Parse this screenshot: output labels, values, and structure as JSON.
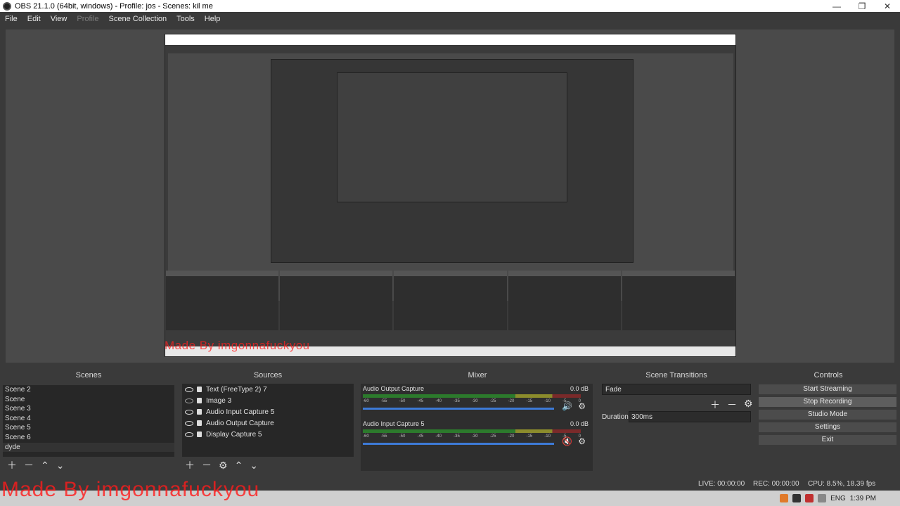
{
  "window": {
    "title": "OBS 21.1.0 (64bit, windows) - Profile: jos - Scenes: kil me",
    "minimize": "—",
    "maximize": "❐",
    "close": "✕"
  },
  "menu": [
    "File",
    "Edit",
    "View",
    "Profile",
    "Scene Collection",
    "Tools",
    "Help"
  ],
  "docks": {
    "scenes": {
      "title": "Scenes",
      "items": [
        "Scene 2",
        "Scene",
        "Scene 3",
        "Scene 4",
        "Scene 5",
        "Scene 6",
        "dyde"
      ]
    },
    "sources": {
      "title": "Sources",
      "items": [
        "Text (FreeType 2) 7",
        "Image 3",
        "Audio Input Capture 5",
        "Audio Output Capture",
        "Display Capture 5"
      ]
    },
    "mixer": {
      "title": "Mixer",
      "channels": [
        {
          "name": "Audio Output Capture",
          "db": "0.0 dB"
        },
        {
          "name": "Audio Input Capture 5",
          "db": "0.0 dB"
        }
      ],
      "ticks": [
        "-60",
        "-55",
        "-50",
        "-45",
        "-40",
        "-35",
        "-30",
        "-25",
        "-20",
        "-15",
        "-10",
        "-5",
        "0"
      ]
    },
    "transitions": {
      "title": "Scene Transitions",
      "selected": "Fade",
      "duration_label": "Duration",
      "duration_value": "300ms"
    },
    "controls": {
      "title": "Controls",
      "buttons": [
        "Start Streaming",
        "Stop Recording",
        "Studio Mode",
        "Settings",
        "Exit"
      ]
    }
  },
  "status": {
    "live": "LIVE: 00:00:00",
    "rec": "REC: 00:00:00",
    "cpu": "CPU: 8.5%, 18.39 fps"
  },
  "watermark": "Made By imgonnafuckyou",
  "taskbar": {
    "lang": "ENG",
    "time": "1:39 PM"
  }
}
